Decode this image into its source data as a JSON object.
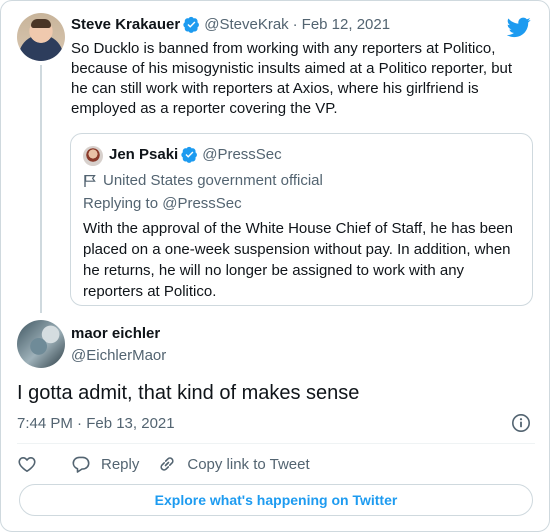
{
  "colors": {
    "accent": "#1d9bf0",
    "muted": "#536471",
    "text": "#0f1419",
    "border": "#cfd9de"
  },
  "parent_tweet": {
    "name": "Steve Krakauer",
    "handle": "@SteveKrak",
    "separator": "·",
    "date": "Feb 12, 2021",
    "text": "So Ducklo is banned from working with any reporters at Politico, because of his misogynistic insults aimed at a Politico reporter, but he can still work with reporters at Axios, where his girlfriend is employed as a reporter covering the VP."
  },
  "quoted_tweet": {
    "name": "Jen Psaki",
    "handle": "@PressSec",
    "label": "United States government official",
    "replying_to": "Replying to @PressSec",
    "text": "With the approval of the White House Chief of Staff, he has been placed on a one-week suspension without pay. In addition, when he returns, he will no longer be assigned to work with any reporters at Politico."
  },
  "main_tweet": {
    "name": "maor eichler",
    "handle": "@EichlerMaor",
    "text": "I gotta admit, that kind of makes sense",
    "timestamp": "7:44 PM · Feb 13, 2021"
  },
  "actions": {
    "reply_label": "Reply",
    "copy_label": "Copy link to Tweet"
  },
  "explore_label": "Explore what's happening on Twitter",
  "icons": [
    "twitter-logo-icon",
    "verified-badge-icon",
    "flag-icon",
    "info-icon",
    "heart-icon",
    "reply-bubble-icon",
    "link-icon"
  ]
}
